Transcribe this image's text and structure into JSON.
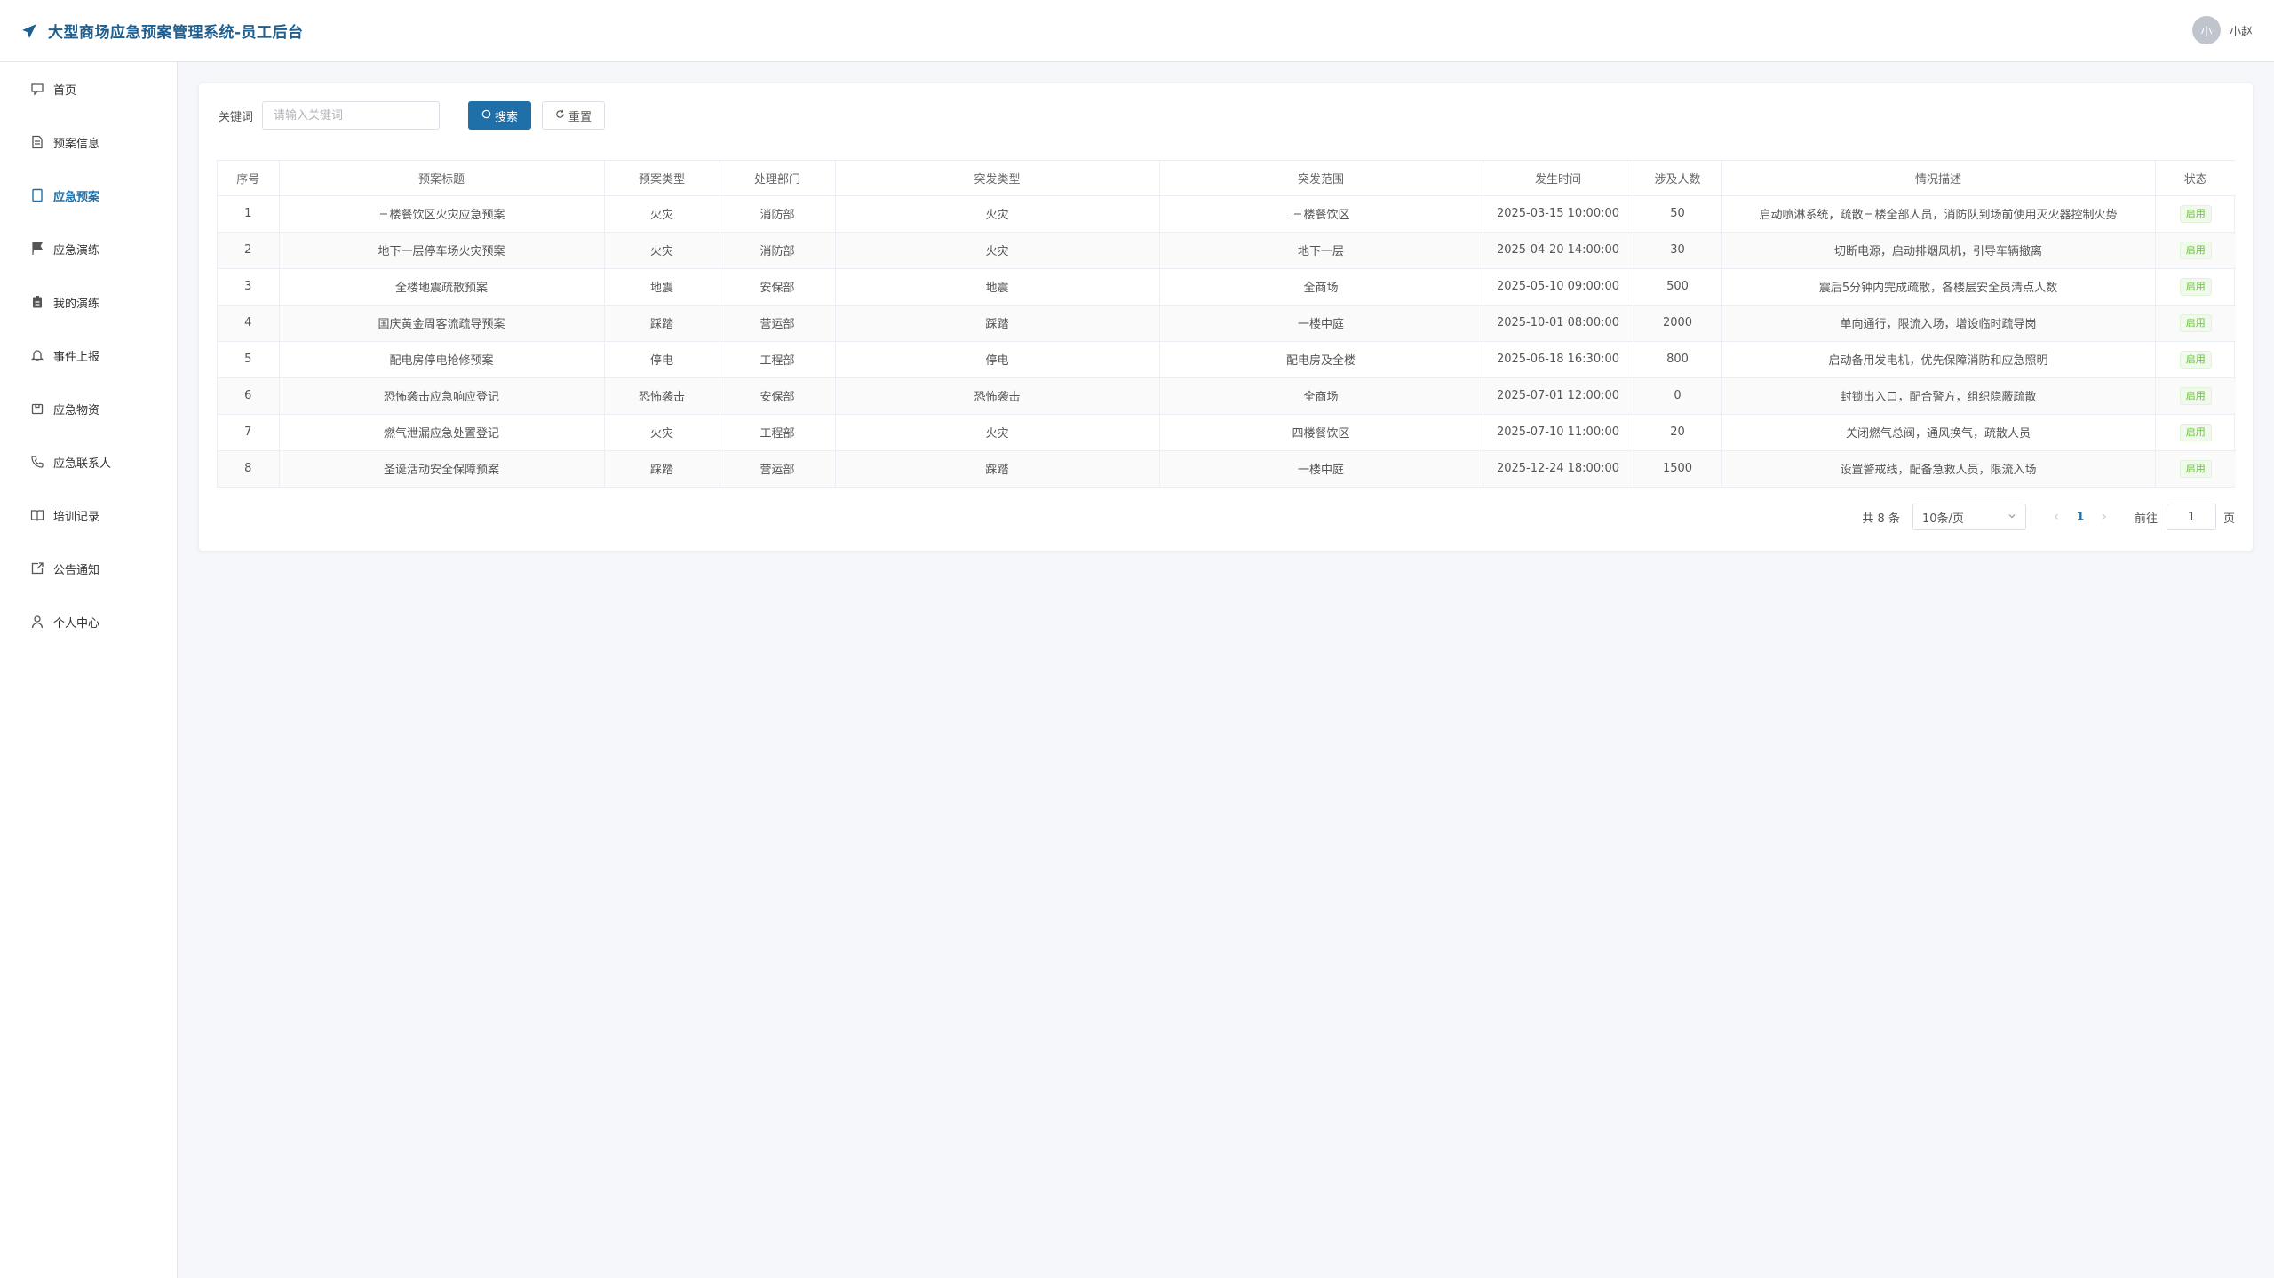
{
  "app": {
    "title": "大型商场应急预案管理系统-员工后台",
    "user": {
      "avatar_char": "小",
      "name": "小赵"
    }
  },
  "sidebar": {
    "items": [
      {
        "label": "首页",
        "icon": "home-icon",
        "active": false
      },
      {
        "label": "预案信息",
        "icon": "document-icon",
        "active": false
      },
      {
        "label": "应急预案",
        "icon": "notebook-icon",
        "active": true
      },
      {
        "label": "应急演练",
        "icon": "flag-icon",
        "active": false
      },
      {
        "label": "我的演练",
        "icon": "clipboard-icon",
        "active": false
      },
      {
        "label": "事件上报",
        "icon": "bell-icon",
        "active": false
      },
      {
        "label": "应急物资",
        "icon": "box-icon",
        "active": false
      },
      {
        "label": "应急联系人",
        "icon": "phone-icon",
        "active": false
      },
      {
        "label": "培训记录",
        "icon": "book-icon",
        "active": false
      },
      {
        "label": "公告通知",
        "icon": "share-icon",
        "active": false
      },
      {
        "label": "个人中心",
        "icon": "user-icon",
        "active": false
      }
    ]
  },
  "search": {
    "label": "关键词",
    "placeholder": "请输入关键词",
    "value": "",
    "search_button": "搜索",
    "reset_button": "重置"
  },
  "table": {
    "columns": [
      "序号",
      "预案标题",
      "预案类型",
      "处理部门",
      "突发类型",
      "突发范围",
      "发生时间",
      "涉及人数",
      "情况描述",
      "状态"
    ],
    "rows": [
      [
        "1",
        "三楼餐饮区火灾应急预案",
        "火灾",
        "消防部",
        "火灾",
        "三楼餐饮区",
        "2025-03-15 10:00:00",
        "50",
        "启动喷淋系统，疏散三楼全部人员，消防队到场前使用灭火器控制火势",
        "启用"
      ],
      [
        "2",
        "地下一层停车场火灾预案",
        "火灾",
        "消防部",
        "火灾",
        "地下一层",
        "2025-04-20 14:00:00",
        "30",
        "切断电源，启动排烟风机，引导车辆撤离",
        "启用"
      ],
      [
        "3",
        "全楼地震疏散预案",
        "地震",
        "安保部",
        "地震",
        "全商场",
        "2025-05-10 09:00:00",
        "500",
        "震后5分钟内完成疏散，各楼层安全员清点人数",
        "启用"
      ],
      [
        "4",
        "国庆黄金周客流疏导预案",
        "踩踏",
        "营运部",
        "踩踏",
        "一楼中庭",
        "2025-10-01 08:00:00",
        "2000",
        "单向通行，限流入场，增设临时疏导岗",
        "启用"
      ],
      [
        "5",
        "配电房停电抢修预案",
        "停电",
        "工程部",
        "停电",
        "配电房及全楼",
        "2025-06-18 16:30:00",
        "800",
        "启动备用发电机，优先保障消防和应急照明",
        "启用"
      ],
      [
        "6",
        "恐怖袭击应急响应登记",
        "恐怖袭击",
        "安保部",
        "恐怖袭击",
        "全商场",
        "2025-07-01 12:00:00",
        "0",
        "封锁出入口，配合警方，组织隐蔽疏散",
        "启用"
      ],
      [
        "7",
        "燃气泄漏应急处置登记",
        "火灾",
        "工程部",
        "火灾",
        "四楼餐饮区",
        "2025-07-10 11:00:00",
        "20",
        "关闭燃气总阀，通风换气，疏散人员",
        "启用"
      ],
      [
        "8",
        "圣诞活动安全保障预案",
        "踩踏",
        "营运部",
        "踩踏",
        "一楼中庭",
        "2025-12-24 18:00:00",
        "1500",
        "设置警戒线，配备急救人员，限流入场",
        "启用"
      ]
    ]
  },
  "pagination": {
    "total": "共 8 条",
    "page_size": "10条/页",
    "current_page": "1",
    "goto_label": "前往",
    "goto_value": "1",
    "page_suffix": "页"
  },
  "colors": {
    "brand": "#1f5f8f",
    "primary": "#1f6fa8",
    "status_green": "#67c23a"
  }
}
